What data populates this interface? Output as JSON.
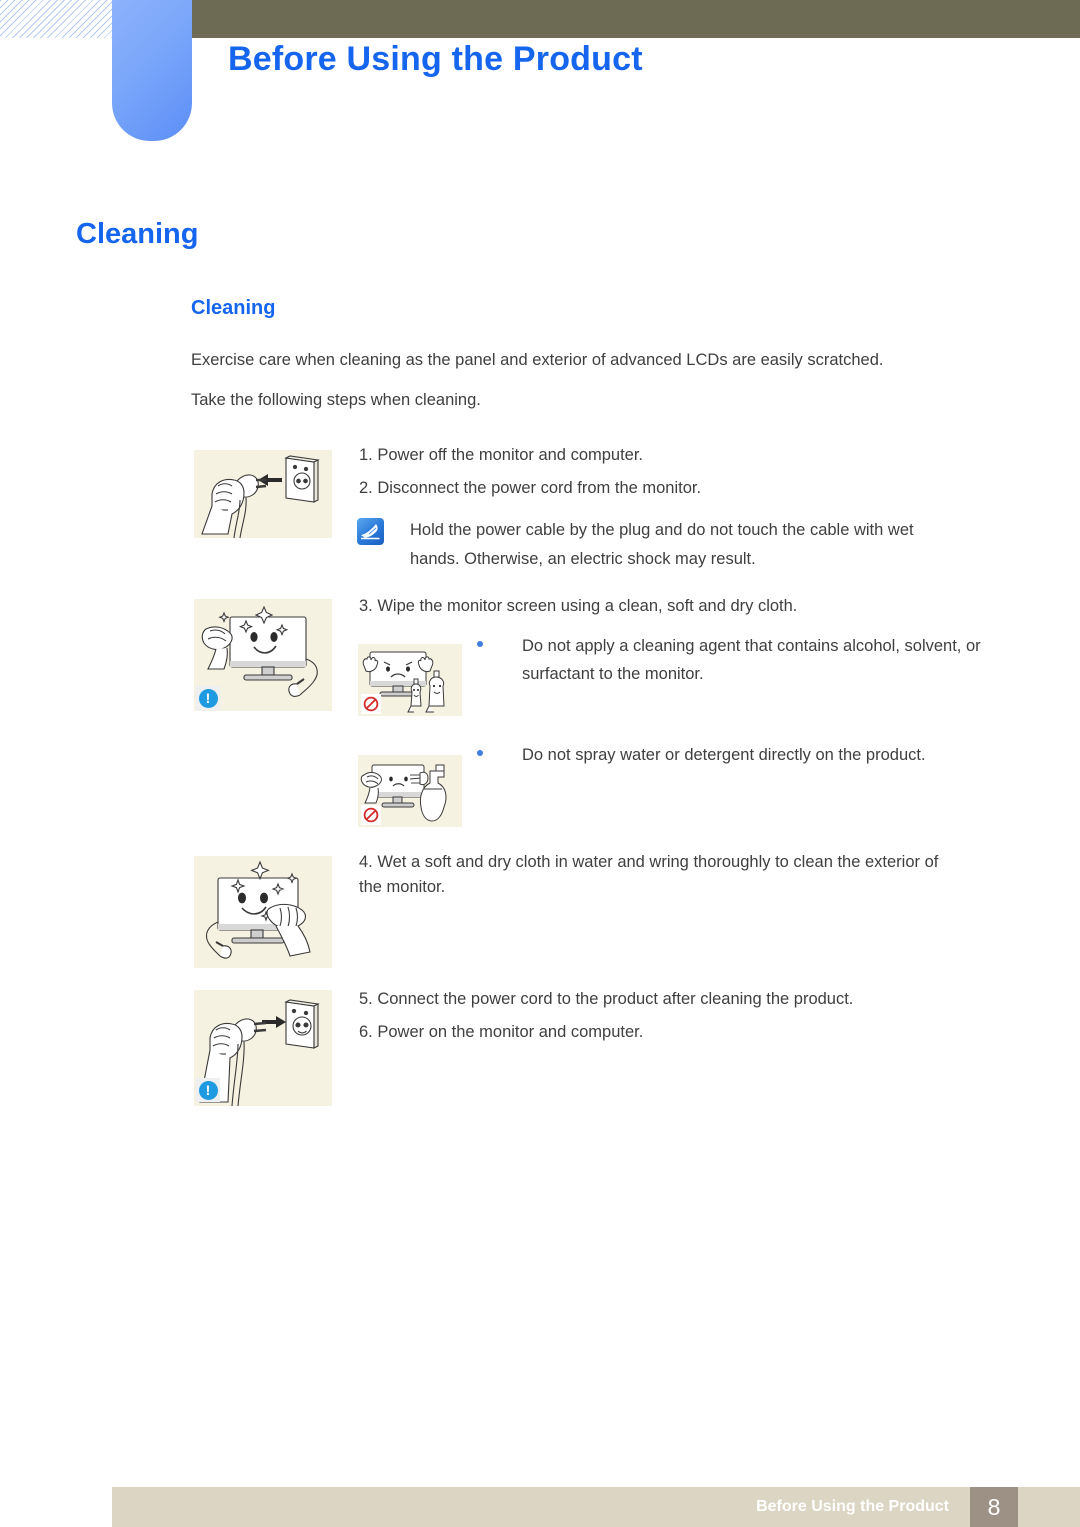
{
  "header": {
    "chapter_title": "Before Using the Product",
    "accent_blue": "#1565ee",
    "tab_blue": "#7aa6fa",
    "bar_olive": "#6e6b54"
  },
  "headings": {
    "section_title": "Cleaning",
    "sub_title": "Cleaning"
  },
  "intro": {
    "line1": "Exercise care when cleaning as the panel and exterior of advanced LCDs are easily scratched.",
    "line2": "Take the following steps when cleaning."
  },
  "steps": {
    "step1": "1. Power off the monitor and computer.",
    "step2": "2. Disconnect the power cord from the monitor.",
    "step3": "3. Wipe the monitor screen using a clean, soft and dry cloth.",
    "step4": "4. Wet a soft and dry cloth in water and wring thoroughly to clean the exterior of the monitor.",
    "step5": "5. Connect the power cord to the product after cleaning the product.",
    "step6": "6. Power on the monitor and computer."
  },
  "note": {
    "icon": "note-pen-icon",
    "text": "Hold the power cable by the plug and do not touch the cable with wet hands. Otherwise, an electric shock may result."
  },
  "bullets": {
    "alcohol": "Do not apply a cleaning agent that contains alcohol, solvent, or surfactant to the monitor.",
    "spray": "Do not spray water or detergent directly on the product."
  },
  "illustrations": {
    "unplug": "hand-unplugging-power-cord-illustration",
    "wipe_screen": "hand-wiping-monitor-screen-illustration",
    "no_cleaning_agent": "no-cleaning-agent-on-monitor-illustration",
    "no_spray": "no-spray-water-on-monitor-illustration",
    "wipe_exterior": "hand-wiping-monitor-exterior-illustration",
    "plug_in": "hand-plugging-power-cord-illustration"
  },
  "badges": {
    "warning_symbol": "!",
    "warning_color": "#1e9ae0",
    "prohibit_color": "#d42a2a"
  },
  "footer": {
    "label": "Before Using the Product",
    "page_number": "8",
    "bar_color": "#ddd5c3",
    "page_box_color": "#9d9084"
  }
}
